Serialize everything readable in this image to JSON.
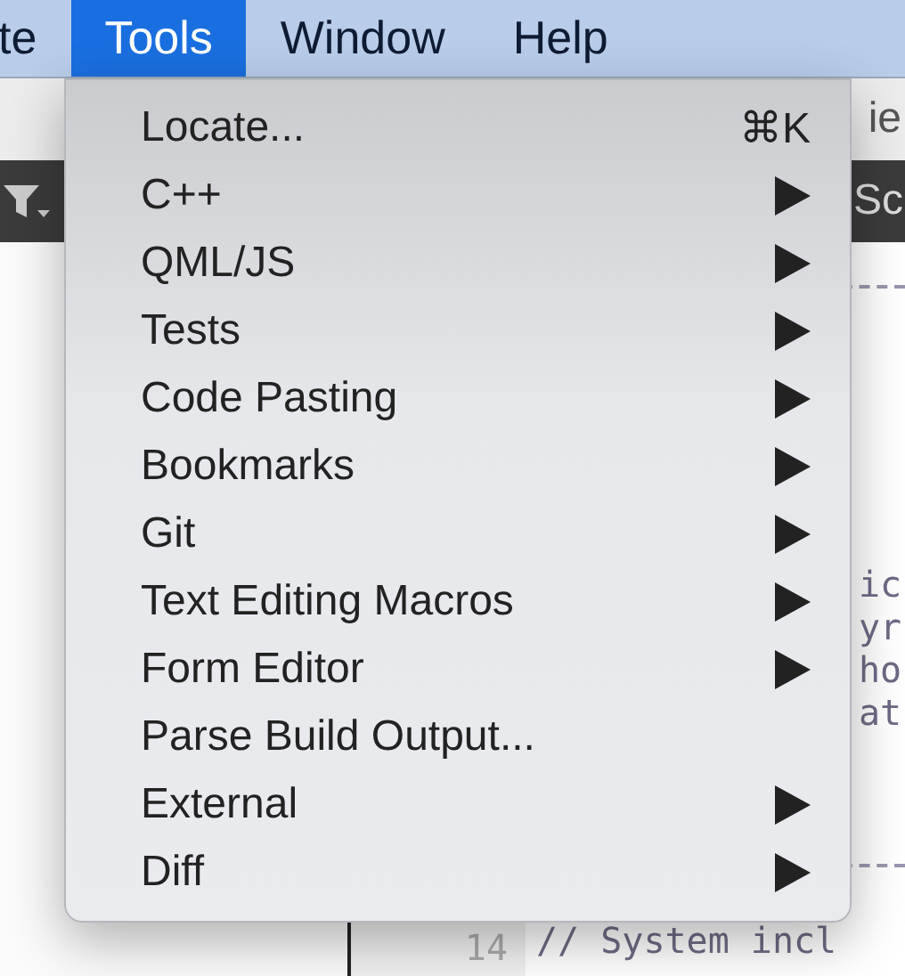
{
  "menubar": [
    {
      "label": "te",
      "selected": false
    },
    {
      "label": "Tools",
      "selected": true
    },
    {
      "label": "Window",
      "selected": false
    },
    {
      "label": "Help",
      "selected": false
    }
  ],
  "toolbar": {
    "text": "ie"
  },
  "dark_bar": {
    "text": "Sc"
  },
  "editor": {
    "code_lines": [
      "ic",
      "yr",
      "ho",
      "at"
    ],
    "line_number": "14",
    "comment": "// System incl"
  },
  "menu": [
    {
      "label": "Locate...",
      "kind": "action",
      "shortcut": "⌘K"
    },
    {
      "label": "C++",
      "kind": "submenu"
    },
    {
      "label": "QML/JS",
      "kind": "submenu"
    },
    {
      "label": "Tests",
      "kind": "submenu"
    },
    {
      "label": "Code Pasting",
      "kind": "submenu"
    },
    {
      "label": "Bookmarks",
      "kind": "submenu"
    },
    {
      "label": "Git",
      "kind": "submenu"
    },
    {
      "label": "Text Editing Macros",
      "kind": "submenu"
    },
    {
      "label": "Form Editor",
      "kind": "submenu"
    },
    {
      "label": "Parse Build Output...",
      "kind": "action"
    },
    {
      "label": "External",
      "kind": "submenu"
    },
    {
      "label": "Diff",
      "kind": "submenu"
    }
  ]
}
